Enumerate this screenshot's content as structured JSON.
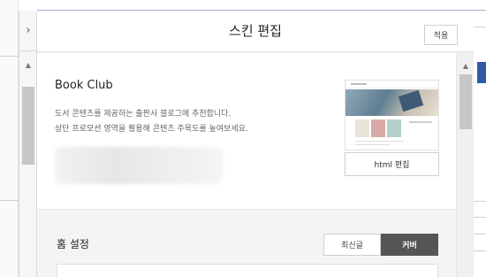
{
  "header": {
    "collapse_icon": "›",
    "title": "스킨 편집",
    "apply_label": "적용"
  },
  "skin": {
    "name": "Book Club",
    "description_line1": "도서 콘텐츠를 제공하는 출판사 블로그에 추천합니다.",
    "description_line2": "상단 프로모션 영역을 활용해 콘텐츠 주목도를 높여보세요.",
    "html_edit_label": "html 편집"
  },
  "home_settings": {
    "label": "홈 설정",
    "options": [
      "최신글",
      "커버"
    ],
    "selected": "커버"
  },
  "scrollbar": {
    "up_arrow": "▲"
  },
  "colors": {
    "accent_line": "#b9a6d6",
    "selected_segment": "#555555",
    "right_edge_blue": "#2f5aa8"
  }
}
